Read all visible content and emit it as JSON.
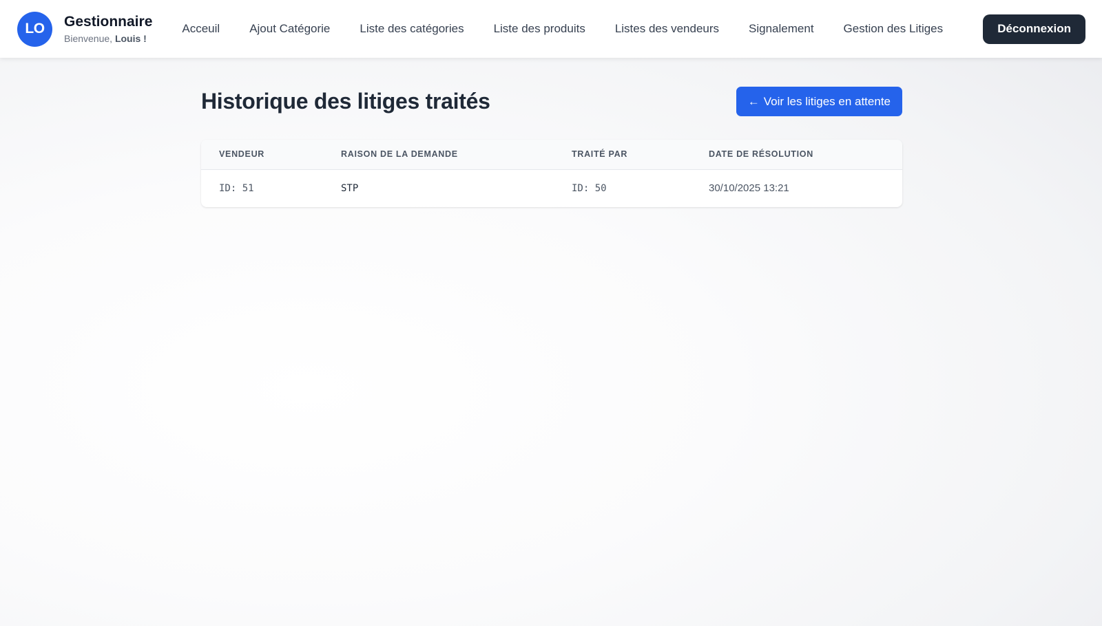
{
  "header": {
    "avatar_initials": "LO",
    "role_title": "Gestionnaire",
    "welcome_prefix": "Bienvenue,",
    "user_name": "Louis !",
    "nav": [
      {
        "label": "Acceuil"
      },
      {
        "label": "Ajout Catégorie"
      },
      {
        "label": "Liste des catégories"
      },
      {
        "label": "Liste des produits"
      },
      {
        "label": "Listes des vendeurs"
      },
      {
        "label": "Signalement"
      },
      {
        "label": "Gestion des Litiges"
      }
    ],
    "logout_label": "Déconnexion"
  },
  "main": {
    "title": "Historique des litiges traités",
    "pending_button": {
      "arrow": "←",
      "label": "Voir les litiges en attente"
    },
    "table": {
      "columns": [
        "Vendeur",
        "Raison de la demande",
        "Traité par",
        "Date de résolution"
      ],
      "rows": [
        {
          "vendeur": "ID: 51",
          "raison": "STP",
          "traite_par": "ID: 50",
          "date": "30/10/2025 13:21"
        }
      ]
    }
  },
  "colors": {
    "accent": "#2563eb",
    "dark": "#1f2937",
    "background": "#f3f4f6"
  },
  "icons": {
    "back_arrow": "arrow-left-icon"
  }
}
